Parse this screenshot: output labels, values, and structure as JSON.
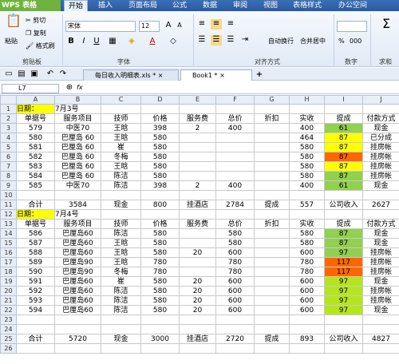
{
  "app": {
    "title": "WPS 表格"
  },
  "menu_tabs": [
    "开始",
    "插入",
    "页面布局",
    "公式",
    "数据",
    "审阅",
    "视图",
    "表格样式",
    "办公空间"
  ],
  "ribbon": {
    "clipboard": {
      "paste": "粘贴",
      "cut": "剪切",
      "copy": "复制",
      "format_painter": "格式刷",
      "label": "剪贴板"
    },
    "font": {
      "name": "宋体",
      "size": "12",
      "label": "字体"
    },
    "align": {
      "wrap": "自动换行",
      "merge": "合并居中",
      "label": "对齐方式"
    },
    "number": {
      "percent": "%",
      "thousands": "000",
      "label": "数字"
    },
    "extra": {
      "label": "求和"
    }
  },
  "doc_tabs": [
    {
      "name": "每日收入明细表.xls *"
    },
    {
      "name": "Book1 *"
    }
  ],
  "formula_bar": {
    "cell_ref": "L7",
    "fx": "fx"
  },
  "columns": [
    "A",
    "B",
    "C",
    "D",
    "E",
    "F",
    "G",
    "H",
    "I",
    "J"
  ],
  "rows": [
    {
      "n": "1",
      "cells": [
        "日期：",
        "7月3号",
        "",
        "",
        "",
        "",
        "",
        "",
        "",
        ""
      ]
    },
    {
      "n": "2",
      "cells": [
        "单据号",
        "服务项目",
        "技师",
        "价格",
        "服务费",
        "总价",
        "折扣",
        "实收",
        "提成",
        "付款方式"
      ]
    },
    {
      "n": "3",
      "cells": [
        "579",
        "中医70",
        "王晗",
        "398",
        "2",
        "400",
        "",
        "400",
        "61",
        "现金"
      ]
    },
    {
      "n": "4",
      "cells": [
        "580",
        "巴厘岛 60",
        "王晗",
        "580",
        "",
        "",
        "",
        "464",
        "87",
        "已分成"
      ]
    },
    {
      "n": "5",
      "cells": [
        "581",
        "巴厘岛 60",
        "崔",
        "580",
        "",
        "",
        "",
        "580",
        "87",
        "挂房帐"
      ]
    },
    {
      "n": "6",
      "cells": [
        "582",
        "巴厘岛 60",
        "冬梅",
        "580",
        "",
        "",
        "",
        "580",
        "87",
        "挂房帐"
      ]
    },
    {
      "n": "7",
      "cells": [
        "583",
        "巴厘岛 60",
        "王晗",
        "580",
        "",
        "",
        "",
        "580",
        "87",
        "挂房帐"
      ]
    },
    {
      "n": "8",
      "cells": [
        "584",
        "巴厘岛 60",
        "陈洁",
        "580",
        "",
        "",
        "",
        "580",
        "87",
        "挂房帐"
      ]
    },
    {
      "n": "9",
      "cells": [
        "585",
        "中医70",
        "陈洁",
        "398",
        "2",
        "400",
        "",
        "400",
        "61",
        "现金"
      ]
    },
    {
      "n": "10",
      "cells": [
        "",
        "",
        "",
        "",
        "",
        "",
        "",
        "",
        "",
        ""
      ]
    },
    {
      "n": "11",
      "cells": [
        "合计",
        "3584",
        "现金",
        "800",
        "挂酒店",
        "2784",
        "提成",
        "557",
        "公司收入",
        "2627"
      ]
    },
    {
      "n": "12",
      "cells": [
        "日期：",
        "7月4号",
        "",
        "",
        "",
        "",
        "",
        "",
        "",
        ""
      ]
    },
    {
      "n": "13",
      "cells": [
        "单据号",
        "服务项目",
        "技师",
        "价格",
        "服务费",
        "总价",
        "折扣",
        "实收",
        "提成",
        "付款方式"
      ]
    },
    {
      "n": "14",
      "cells": [
        "586",
        "巴厘岛60",
        "陈洁",
        "580",
        "",
        "580",
        "",
        "580",
        "87",
        "现金"
      ]
    },
    {
      "n": "15",
      "cells": [
        "587",
        "巴厘岛60",
        "王晗",
        "580",
        "",
        "580",
        "",
        "580",
        "87",
        "现金"
      ]
    },
    {
      "n": "16",
      "cells": [
        "588",
        "巴厘岛60",
        "王晗",
        "580",
        "20",
        "600",
        "",
        "600",
        "97",
        "挂房帐"
      ]
    },
    {
      "n": "17",
      "cells": [
        "589",
        "巴厘岛90",
        "王晗",
        "780",
        "",
        "780",
        "",
        "780",
        "117",
        "挂房帐"
      ]
    },
    {
      "n": "18",
      "cells": [
        "590",
        "巴厘岛90",
        "冬梅",
        "780",
        "",
        "780",
        "",
        "780",
        "117",
        "挂房帐"
      ]
    },
    {
      "n": "19",
      "cells": [
        "591",
        "巴厘岛60",
        "崔",
        "580",
        "20",
        "600",
        "",
        "600",
        "97",
        "现金"
      ]
    },
    {
      "n": "20",
      "cells": [
        "592",
        "巴厘岛60",
        "陈洁",
        "580",
        "20",
        "600",
        "",
        "600",
        "97",
        "挂房帐"
      ]
    },
    {
      "n": "21",
      "cells": [
        "593",
        "巴厘岛60",
        "陈洁",
        "580",
        "20",
        "600",
        "",
        "600",
        "97",
        "挂房帐"
      ]
    },
    {
      "n": "22",
      "cells": [
        "594",
        "巴厘岛60",
        "陈洁",
        "580",
        "20",
        "600",
        "",
        "600",
        "97",
        "现金"
      ]
    },
    {
      "n": "23",
      "cells": [
        "",
        "",
        "",
        "",
        "",
        "",
        "",
        "",
        "",
        ""
      ]
    },
    {
      "n": "24",
      "cells": [
        "",
        "",
        "",
        "",
        "",
        "",
        "",
        "",
        "",
        ""
      ]
    },
    {
      "n": "25",
      "cells": [
        "合计",
        "5720",
        "现金",
        "3000",
        "挂酒店",
        "2720",
        "提成",
        "893",
        "公司收入",
        "4827"
      ]
    },
    {
      "n": "26",
      "cells": [
        "",
        "",
        "",
        "",
        "",
        "",
        "",
        "",
        "",
        ""
      ]
    }
  ],
  "fills": {
    "yellow": "#ffff00",
    "green": "#92d050",
    "orange": "#ff6600",
    "lime": "#b5e61d"
  }
}
